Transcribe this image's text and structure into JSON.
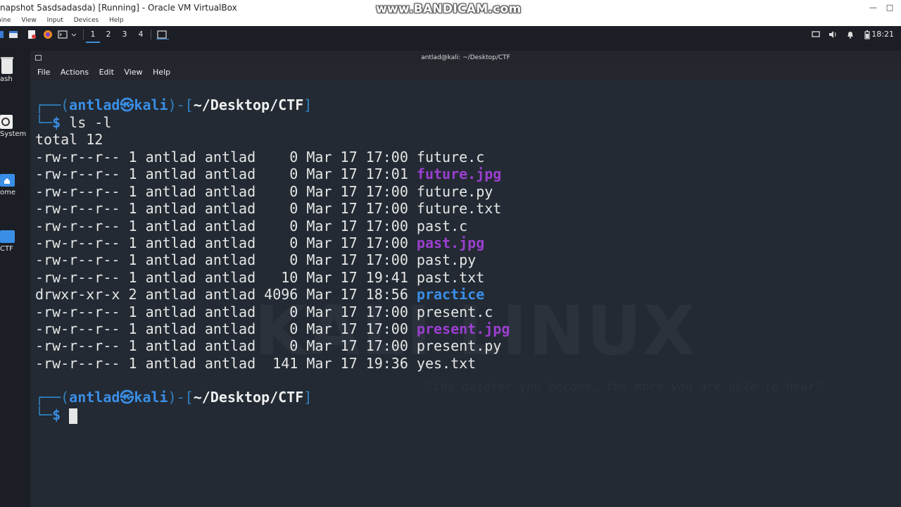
{
  "host": {
    "window_title": "napshot 5asdsadasda) [Running] - Oracle VM VirtualBox",
    "watermark": "www.BANDICAM.com",
    "window_buttons": [
      "—",
      "□"
    ],
    "menu": [
      "hine",
      "View",
      "Input",
      "Devices",
      "Help"
    ]
  },
  "panel": {
    "workspaces": [
      "1",
      "2",
      "3",
      "4"
    ],
    "active_workspace": "1",
    "clock": "18:21"
  },
  "desktop": {
    "icons": [
      {
        "label": "ash",
        "icon": "trash-icon"
      },
      {
        "label": "System",
        "icon": "filesystem-icon"
      },
      {
        "label": "ome",
        "icon": "home-folder-icon"
      },
      {
        "label": "CTF",
        "icon": "folder-icon"
      }
    ]
  },
  "terminal": {
    "title": "antlad@kali: ~/Desktop/CTF",
    "menu": [
      "File",
      "Actions",
      "Edit",
      "View",
      "Help"
    ],
    "background_watermark": "KALI LINUX",
    "background_tagline": "\"the quieter you become, the more you are able to hear\"",
    "prompt": {
      "user": "antlad",
      "at_symbol": "㉿",
      "host": "kali",
      "path": "~/Desktop/CTF",
      "dollar": "$"
    },
    "command": "ls -l",
    "total_line": "total 12",
    "listing": [
      {
        "perms": "-rw-r--r--",
        "links": "1",
        "owner": "antlad",
        "group": "antlad",
        "size": "   0",
        "date": "Mar 17 17:00",
        "name": "future.c",
        "kind": "file"
      },
      {
        "perms": "-rw-r--r--",
        "links": "1",
        "owner": "antlad",
        "group": "antlad",
        "size": "   0",
        "date": "Mar 17 17:01",
        "name": "future.jpg",
        "kind": "image"
      },
      {
        "perms": "-rw-r--r--",
        "links": "1",
        "owner": "antlad",
        "group": "antlad",
        "size": "   0",
        "date": "Mar 17 17:00",
        "name": "future.py",
        "kind": "file"
      },
      {
        "perms": "-rw-r--r--",
        "links": "1",
        "owner": "antlad",
        "group": "antlad",
        "size": "   0",
        "date": "Mar 17 17:00",
        "name": "future.txt",
        "kind": "file"
      },
      {
        "perms": "-rw-r--r--",
        "links": "1",
        "owner": "antlad",
        "group": "antlad",
        "size": "   0",
        "date": "Mar 17 17:00",
        "name": "past.c",
        "kind": "file"
      },
      {
        "perms": "-rw-r--r--",
        "links": "1",
        "owner": "antlad",
        "group": "antlad",
        "size": "   0",
        "date": "Mar 17 17:00",
        "name": "past.jpg",
        "kind": "image"
      },
      {
        "perms": "-rw-r--r--",
        "links": "1",
        "owner": "antlad",
        "group": "antlad",
        "size": "   0",
        "date": "Mar 17 17:00",
        "name": "past.py",
        "kind": "file"
      },
      {
        "perms": "-rw-r--r--",
        "links": "1",
        "owner": "antlad",
        "group": "antlad",
        "size": "  10",
        "date": "Mar 17 19:41",
        "name": "past.txt",
        "kind": "file"
      },
      {
        "perms": "drwxr-xr-x",
        "links": "2",
        "owner": "antlad",
        "group": "antlad",
        "size": "4096",
        "date": "Mar 17 18:56",
        "name": "practice",
        "kind": "dir"
      },
      {
        "perms": "-rw-r--r--",
        "links": "1",
        "owner": "antlad",
        "group": "antlad",
        "size": "   0",
        "date": "Mar 17 17:00",
        "name": "present.c",
        "kind": "file"
      },
      {
        "perms": "-rw-r--r--",
        "links": "1",
        "owner": "antlad",
        "group": "antlad",
        "size": "   0",
        "date": "Mar 17 17:00",
        "name": "present.jpg",
        "kind": "image"
      },
      {
        "perms": "-rw-r--r--",
        "links": "1",
        "owner": "antlad",
        "group": "antlad",
        "size": "   0",
        "date": "Mar 17 17:00",
        "name": "present.py",
        "kind": "file"
      },
      {
        "perms": "-rw-r--r--",
        "links": "1",
        "owner": "antlad",
        "group": "antlad",
        "size": " 141",
        "date": "Mar 17 19:36",
        "name": "yes.txt",
        "kind": "file"
      }
    ]
  },
  "colors": {
    "prompt_blue": "#3a8ee6",
    "image_purple": "#9b3fcf",
    "directory_blue": "#3a8ee6",
    "terminal_bg": "#232a33"
  }
}
